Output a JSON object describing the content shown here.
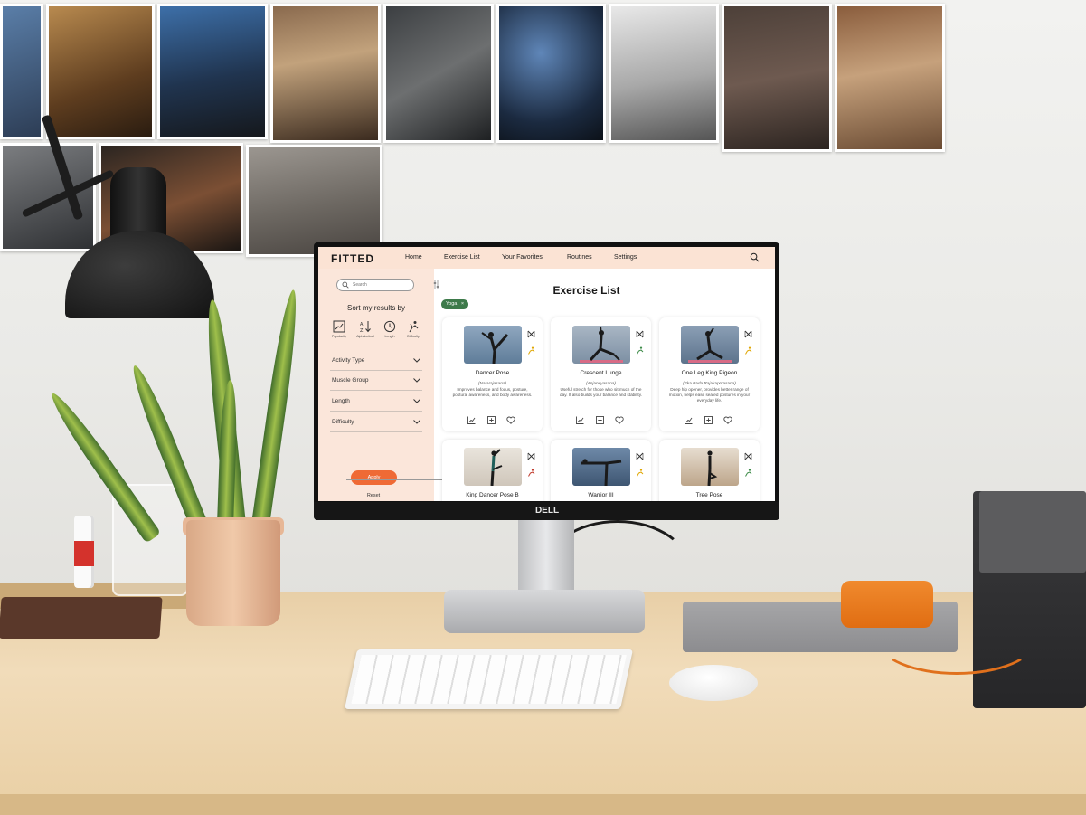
{
  "app": {
    "logo": "FITTED",
    "nav": [
      "Home",
      "Exercise List",
      "Your Favorites",
      "Routines",
      "Settings"
    ]
  },
  "sidebar": {
    "search_placeholder": "Search",
    "sort_title": "Sort my results by",
    "sort_options": [
      "Popularity",
      "Alphabetical",
      "Length",
      "Difficulty"
    ],
    "filters": [
      "Activity Type",
      "Muscle Group",
      "Length",
      "Difficulty"
    ],
    "apply_label": "Apply",
    "reset_label": "Reset"
  },
  "main": {
    "title": "Exercise List",
    "active_filter": "Yoga"
  },
  "cards": [
    {
      "name": "Dancer Pose",
      "sanskrit": "(Natarajasana)",
      "desc": "Improves balance and focus, posture, postural awareness, and body awareness."
    },
    {
      "name": "Crescent Lunge",
      "sanskrit": "(Anjaneyasana)",
      "desc": "Useful stretch for those who sit much of the day. It also builds your balance and stability."
    },
    {
      "name": "One Leg King Pigeon",
      "sanskrit": "(Eka Pada Rajakapotasana)",
      "desc": "Deep hip opener, provides better range of motion, helps ease seated postures in your everyday life."
    },
    {
      "name": "King Dancer Pose B",
      "sanskrit": "",
      "desc": ""
    },
    {
      "name": "Warrior III",
      "sanskrit": "",
      "desc": ""
    },
    {
      "name": "Tree Pose",
      "sanskrit": "",
      "desc": ""
    }
  ],
  "monitor_brand": "DELL",
  "colors": {
    "accent": "#ef6a35",
    "header": "#fbe3d4",
    "sidebar": "#fbe6da",
    "chip": "#3d7a4a"
  }
}
